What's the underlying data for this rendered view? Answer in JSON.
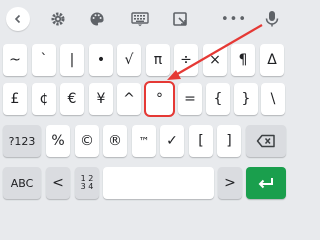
{
  "toolbar": {
    "icons": [
      "chevron-left-icon",
      "gear-icon",
      "palette-icon",
      "keyboard-icon",
      "screenshot-icon",
      "more-dots-icon",
      "microphone-icon"
    ],
    "more_label": "•••"
  },
  "keys": {
    "row1": [
      "~",
      "`",
      "|",
      "•",
      "√",
      "π",
      "÷",
      "×",
      "¶",
      "Δ"
    ],
    "row2": [
      "£",
      "¢",
      "€",
      "¥",
      "^",
      "°",
      "=",
      "{",
      "}",
      "\\"
    ],
    "row3": [
      "?123",
      "%",
      "©",
      "®",
      "™",
      "✓",
      "[",
      "]"
    ],
    "row4": [
      "ABC",
      "<",
      ",",
      ">"
    ],
    "numpad_label": "1 2\n3 4"
  },
  "colors": {
    "highlight": "#e53935",
    "enter": "#1a9f4d",
    "keyboard_bg": "#e8eaed"
  }
}
